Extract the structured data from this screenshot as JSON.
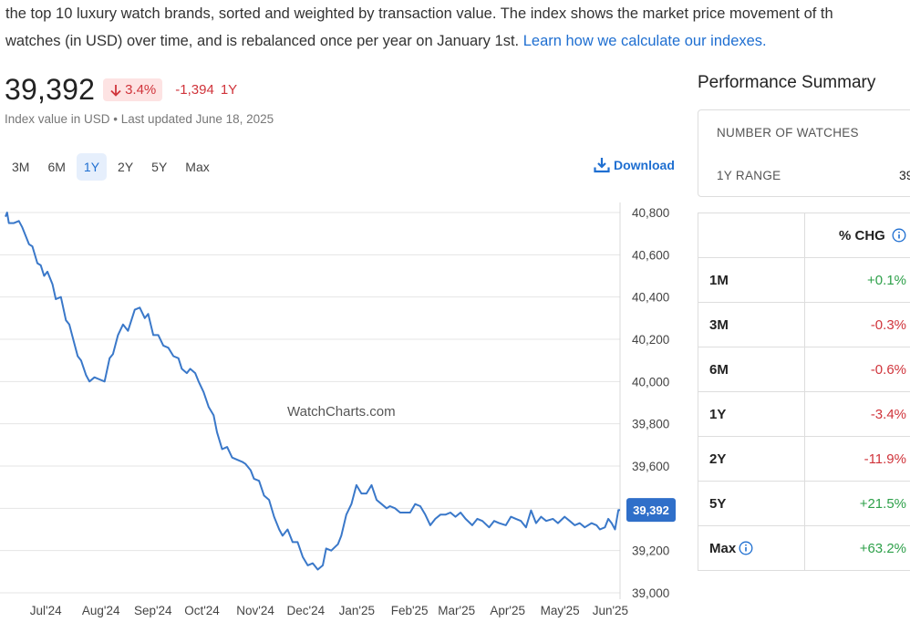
{
  "intro": {
    "line1": "the top 10 luxury watch brands, sorted and weighted by transaction value. The index shows the market price movement of th",
    "line2_text": "watches (in USD) over time, and is rebalanced once per year on January 1st.",
    "link": "Learn how we calculate our indexes."
  },
  "summary": {
    "value": "39,392",
    "pct_change": "3.4%",
    "abs_change": "-1,394",
    "period": "1Y",
    "subline": "Index value in USD • Last updated June 18, 2025"
  },
  "tabs": [
    "3M",
    "6M",
    "1Y",
    "2Y",
    "5Y",
    "Max"
  ],
  "active_tab": "1Y",
  "download_label": "Download",
  "watermark": "WatchCharts.com",
  "colors": {
    "line": "#3a78c9",
    "badge_bg": "#fde3e3",
    "negative": "#d0343b",
    "positive": "#2ea04a",
    "accent": "#1f6fd1"
  },
  "chart_data": {
    "type": "line",
    "title": "",
    "xlabel": "",
    "ylabel": "",
    "ylim": [
      39000,
      40800
    ],
    "yticks": [
      40800,
      40600,
      40400,
      40200,
      40000,
      39800,
      39600,
      39400,
      39200,
      39000
    ],
    "ytick_labels": [
      "40,800",
      "40,600",
      "40,400",
      "40,200",
      "40,000",
      "39,800",
      "39,600",
      "39,400",
      "39,200",
      "39,000"
    ],
    "xlim": [
      "2024-06-17",
      "2025-06-18"
    ],
    "x_ticks": [
      {
        "date": "2024-07-01",
        "label": "Jul'24"
      },
      {
        "date": "2024-08-01",
        "label": "Aug'24"
      },
      {
        "date": "2024-09-01",
        "label": "Sep'24"
      },
      {
        "date": "2024-10-01",
        "label": "Oct'24"
      },
      {
        "date": "2024-11-01",
        "label": "Nov'24"
      },
      {
        "date": "2024-12-01",
        "label": "Dec'24"
      },
      {
        "date": "2025-01-01",
        "label": "Jan'25"
      },
      {
        "date": "2025-02-01",
        "label": "Feb'25"
      },
      {
        "date": "2025-03-01",
        "label": "Mar'25"
      },
      {
        "date": "2025-04-01",
        "label": "Apr'25"
      },
      {
        "date": "2025-05-01",
        "label": "May'25"
      },
      {
        "date": "2025-06-01",
        "label": "Jun'25"
      }
    ],
    "grid": true,
    "current_label": "39,392",
    "series": [
      {
        "x": [
          "2024-06-17",
          "2024-06-18",
          "2024-06-19",
          "2024-06-22",
          "2024-06-25",
          "2024-06-27",
          "2024-07-01",
          "2024-07-03",
          "2024-07-06",
          "2024-07-08",
          "2024-07-10",
          "2024-07-12",
          "2024-07-15",
          "2024-07-17",
          "2024-07-20",
          "2024-07-23",
          "2024-07-25",
          "2024-07-28",
          "2024-07-30",
          "2024-08-01",
          "2024-08-04",
          "2024-08-06",
          "2024-08-09",
          "2024-08-12",
          "2024-08-15",
          "2024-08-18",
          "2024-08-20",
          "2024-08-23",
          "2024-08-26",
          "2024-08-29",
          "2024-09-02",
          "2024-09-05",
          "2024-09-08",
          "2024-09-10",
          "2024-09-13",
          "2024-09-16",
          "2024-09-19",
          "2024-09-22",
          "2024-09-25",
          "2024-09-28",
          "2024-09-30",
          "2024-10-03",
          "2024-10-05",
          "2024-10-08",
          "2024-10-10",
          "2024-10-13",
          "2024-10-16",
          "2024-10-19",
          "2024-10-21",
          "2024-10-24",
          "2024-10-27",
          "2024-10-30",
          "2024-11-02",
          "2024-11-05",
          "2024-11-07",
          "2024-11-10",
          "2024-11-12",
          "2024-11-15",
          "2024-11-18",
          "2024-11-21",
          "2024-11-24",
          "2024-11-27",
          "2024-11-29",
          "2024-12-02",
          "2024-12-05",
          "2024-12-08",
          "2024-12-11",
          "2024-12-14",
          "2024-12-17",
          "2024-12-20",
          "2024-12-23",
          "2024-12-25",
          "2024-12-28",
          "2025-01-01",
          "2025-01-03",
          "2025-01-06",
          "2025-01-09",
          "2025-01-12",
          "2025-01-15",
          "2025-01-18",
          "2025-01-21",
          "2025-01-24",
          "2025-01-27",
          "2025-01-30",
          "2025-02-01",
          "2025-02-04",
          "2025-02-07",
          "2025-02-10",
          "2025-02-13",
          "2025-02-16",
          "2025-02-19",
          "2025-02-22",
          "2025-02-25",
          "2025-02-28",
          "2025-03-03",
          "2025-03-06",
          "2025-03-09",
          "2025-03-12",
          "2025-03-15",
          "2025-03-18",
          "2025-03-22",
          "2025-03-25",
          "2025-03-28",
          "2025-04-01",
          "2025-04-04",
          "2025-04-07",
          "2025-04-11",
          "2025-04-14",
          "2025-04-17",
          "2025-04-20",
          "2025-04-23",
          "2025-04-26",
          "2025-04-29",
          "2025-05-02",
          "2025-05-05",
          "2025-05-09",
          "2025-05-12",
          "2025-05-16",
          "2025-05-19",
          "2025-05-22",
          "2025-05-25",
          "2025-05-28",
          "2025-06-01",
          "2025-06-04",
          "2025-06-06",
          "2025-06-09",
          "2025-06-11",
          "2025-06-13",
          "2025-06-15",
          "2025-06-17",
          "2025-06-18"
        ],
        "y": [
          40780,
          40800,
          40750,
          40750,
          40760,
          40730,
          40650,
          40640,
          40560,
          40550,
          40500,
          40520,
          40460,
          40390,
          40400,
          40290,
          40270,
          40180,
          40120,
          40100,
          40030,
          40000,
          40020,
          40010,
          40000,
          40110,
          40130,
          40220,
          40270,
          40240,
          40340,
          40350,
          40300,
          40320,
          40220,
          40220,
          40170,
          40160,
          40120,
          40110,
          40060,
          40040,
          40060,
          40040,
          40000,
          39950,
          39880,
          39840,
          39760,
          39680,
          39690,
          39640,
          39630,
          39620,
          39610,
          39580,
          39540,
          39530,
          39460,
          39440,
          39360,
          39300,
          39270,
          39300,
          39240,
          39240,
          39170,
          39130,
          39140,
          39110,
          39130,
          39210,
          39200,
          39230,
          39270,
          39370,
          39420,
          39510,
          39470,
          39470,
          39510,
          39440,
          39420,
          39400,
          39410,
          39400,
          39380,
          39380,
          39380,
          39420,
          39410,
          39370,
          39320,
          39350,
          39370,
          39370,
          39380,
          39360,
          39380,
          39350,
          39320,
          39350,
          39340,
          39310,
          39340,
          39330,
          39320,
          39360,
          39350,
          39340,
          39310,
          39390,
          39330,
          39360,
          39340,
          39350,
          39330,
          39360,
          39340,
          39320,
          39330,
          39310,
          39330,
          39320,
          39300,
          39310,
          39350,
          39330,
          39300,
          39392,
          39392
        ]
      }
    ]
  },
  "performance": {
    "title": "Performance Summary",
    "stats": [
      {
        "label": "NUMBER OF WATCHES",
        "value": ""
      },
      {
        "label": "1Y RANGE",
        "value": "39"
      }
    ],
    "table_header": "% CHG",
    "rows": [
      {
        "period": "1M",
        "change": "+0.1%",
        "dir": "pos"
      },
      {
        "period": "3M",
        "change": "-0.3%",
        "dir": "neg"
      },
      {
        "period": "6M",
        "change": "-0.6%",
        "dir": "neg"
      },
      {
        "period": "1Y",
        "change": "-3.4%",
        "dir": "neg"
      },
      {
        "period": "2Y",
        "change": "-11.9%",
        "dir": "neg"
      },
      {
        "period": "5Y",
        "change": "+21.5%",
        "dir": "pos"
      },
      {
        "period": "Max",
        "change": "+63.2%",
        "dir": "pos"
      }
    ]
  }
}
